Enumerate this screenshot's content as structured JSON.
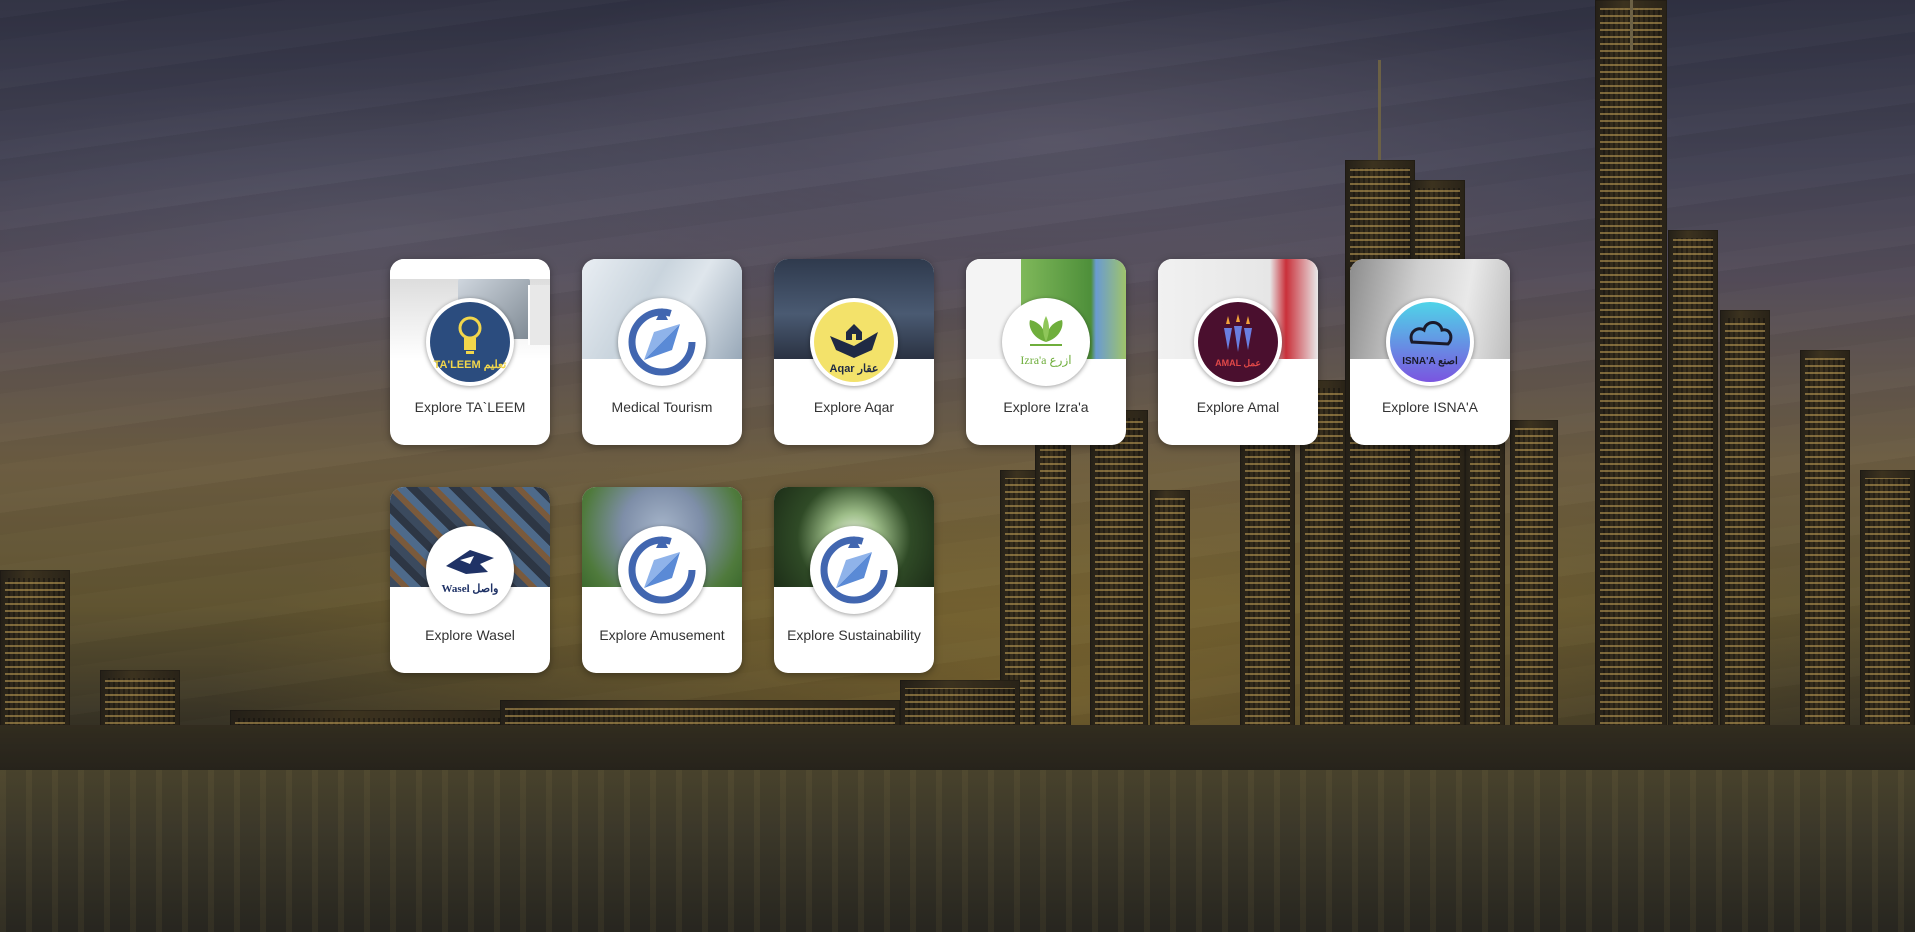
{
  "cards": [
    {
      "label": "Explore TA`LEEM",
      "logo_text": "TA'LEEM تعليم"
    },
    {
      "label": "Medical Tourism"
    },
    {
      "label": "Explore Aqar",
      "logo_text": "Aqar عقار"
    },
    {
      "label": "Explore Izra'a",
      "logo_text": "Izra'a ازرع"
    },
    {
      "label": "Explore Amal",
      "logo_text": "AMAL عمل"
    },
    {
      "label": "Explore ISNA'A",
      "logo_text": "ISNA'A اصنع"
    },
    {
      "label": "Explore Wasel",
      "logo_text": "Wasel واصل"
    },
    {
      "label": "Explore Amusement"
    },
    {
      "label": "Explore Sustainability"
    }
  ]
}
